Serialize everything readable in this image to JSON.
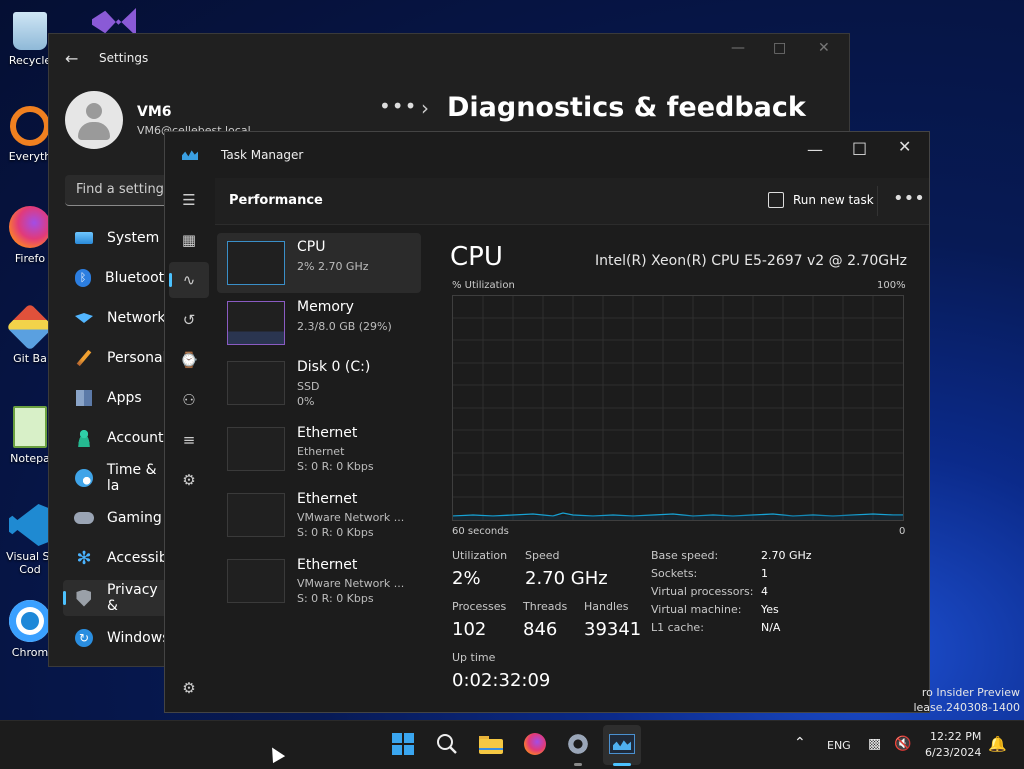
{
  "desktop": {
    "icons": [
      {
        "label": "Recycle"
      },
      {
        "label": "Everyth"
      },
      {
        "label": "Firefo"
      },
      {
        "label": "Git Ba"
      },
      {
        "label": "Notepa"
      },
      {
        "label": "Visual St\nCod"
      },
      {
        "label": "Chrom"
      }
    ]
  },
  "settings": {
    "title": "Settings",
    "user_name": "VM6",
    "user_email": "VM6@cellebest.local",
    "breadcrumb_more": "•••",
    "page_title": "Diagnostics & feedback",
    "search_placeholder": "Find a setting",
    "nav": [
      {
        "label": "System",
        "icon": "monitor-icon"
      },
      {
        "label": "Bluetooth",
        "icon": "bluetooth-icon"
      },
      {
        "label": "Network",
        "icon": "wifi-icon"
      },
      {
        "label": "Personali",
        "icon": "brush-icon"
      },
      {
        "label": "Apps",
        "icon": "apps-icon"
      },
      {
        "label": "Accounts",
        "icon": "person-icon"
      },
      {
        "label": "Time & la",
        "icon": "clock-globe-icon"
      },
      {
        "label": "Gaming",
        "icon": "gamepad-icon"
      },
      {
        "label": "Accessibi",
        "icon": "accessibility-icon"
      },
      {
        "label": "Privacy &",
        "icon": "shield-icon"
      },
      {
        "label": "Windows",
        "icon": "update-icon"
      }
    ]
  },
  "taskmgr": {
    "title": "Task Manager",
    "header_title": "Performance",
    "run_new_task": "Run new task",
    "more": "•••",
    "items": [
      {
        "name": "CPU",
        "sub1": "2% 2.70 GHz",
        "sub2": ""
      },
      {
        "name": "Memory",
        "sub1": "2.3/8.0 GB (29%)",
        "sub2": ""
      },
      {
        "name": "Disk 0 (C:)",
        "sub1": "SSD",
        "sub2": "0%"
      },
      {
        "name": "Ethernet",
        "sub1": "Ethernet",
        "sub2": "S: 0 R: 0 Kbps"
      },
      {
        "name": "Ethernet",
        "sub1": "VMware Network ...",
        "sub2": "S: 0 R: 0 Kbps"
      },
      {
        "name": "Ethernet",
        "sub1": "VMware Network ...",
        "sub2": "S: 0 R: 0 Kbps"
      }
    ],
    "cpu": {
      "title": "CPU",
      "model": "Intel(R) Xeon(R) CPU E5-2697 v2 @ 2.70GHz",
      "graph_label_top_left": "% Utilization",
      "graph_label_top_right": "100%",
      "graph_label_bottom_left": "60 seconds",
      "graph_label_bottom_right": "0",
      "utilization_label": "Utilization",
      "utilization": "2%",
      "speed_label": "Speed",
      "speed": "2.70 GHz",
      "processes_label": "Processes",
      "processes": "102",
      "threads_label": "Threads",
      "threads": "846",
      "handles_label": "Handles",
      "handles": "39341",
      "uptime_label": "Up time",
      "uptime": "0:02:32:09",
      "details": [
        {
          "k": "Base speed:",
          "v": "2.70 GHz"
        },
        {
          "k": "Sockets:",
          "v": "1"
        },
        {
          "k": "Virtual processors:",
          "v": "4"
        },
        {
          "k": "Virtual machine:",
          "v": "Yes"
        },
        {
          "k": "L1 cache:",
          "v": "N/A"
        }
      ]
    }
  },
  "watermark": {
    "line1": "ro Insider Preview",
    "line2": "lease.240308-1400"
  },
  "taskbar": {
    "lang": "ENG",
    "time": "12:22 PM",
    "date": "6/23/2024"
  },
  "colors": {
    "accent": "#4cc2ff",
    "graph_line": "#17a3d6"
  }
}
